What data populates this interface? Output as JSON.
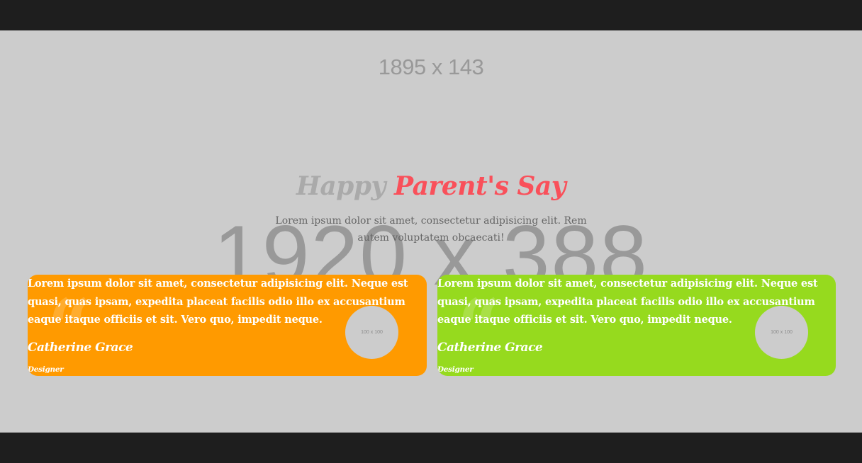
{
  "banner": {
    "placeholder": "1895 x 143"
  },
  "section": {
    "background_placeholder": "1920 x 388",
    "heading_muted": "Happy",
    "heading_accent": "Parent's Say",
    "subtitle": "Lorem ipsum dolor sit amet, consectetur adipisicing elit. Rem autem voluptatem obcaecati!"
  },
  "testimonials": [
    {
      "text": "Lorem ipsum dolor sit amet, consectetur adipisicing elit. Neque est quasi, quas ipsam, expedita placeat facilis odio illo ex accusantium eaque itaque officiis et sit. Vero quo, impedit neque.",
      "name": "Catherine Grace",
      "role": "Designer",
      "avatar_placeholder": "100 x 100",
      "quote_glyph": "“",
      "color": "#ff9a00"
    },
    {
      "text": "Lorem ipsum dolor sit amet, consectetur adipisicing elit. Neque est quasi, quas ipsam, expedita placeat facilis odio illo ex accusantium eaque itaque officiis et sit. Vero quo, impedit neque.",
      "name": "Catherine Grace",
      "role": "Designer",
      "avatar_placeholder": "100 x 100",
      "quote_glyph": "“",
      "color": "#96da1e"
    }
  ],
  "colors": {
    "accent": "#f9505a",
    "muted_heading": "#aaaaaa",
    "background": "#cccccc",
    "frame": "#1e1e1e"
  }
}
